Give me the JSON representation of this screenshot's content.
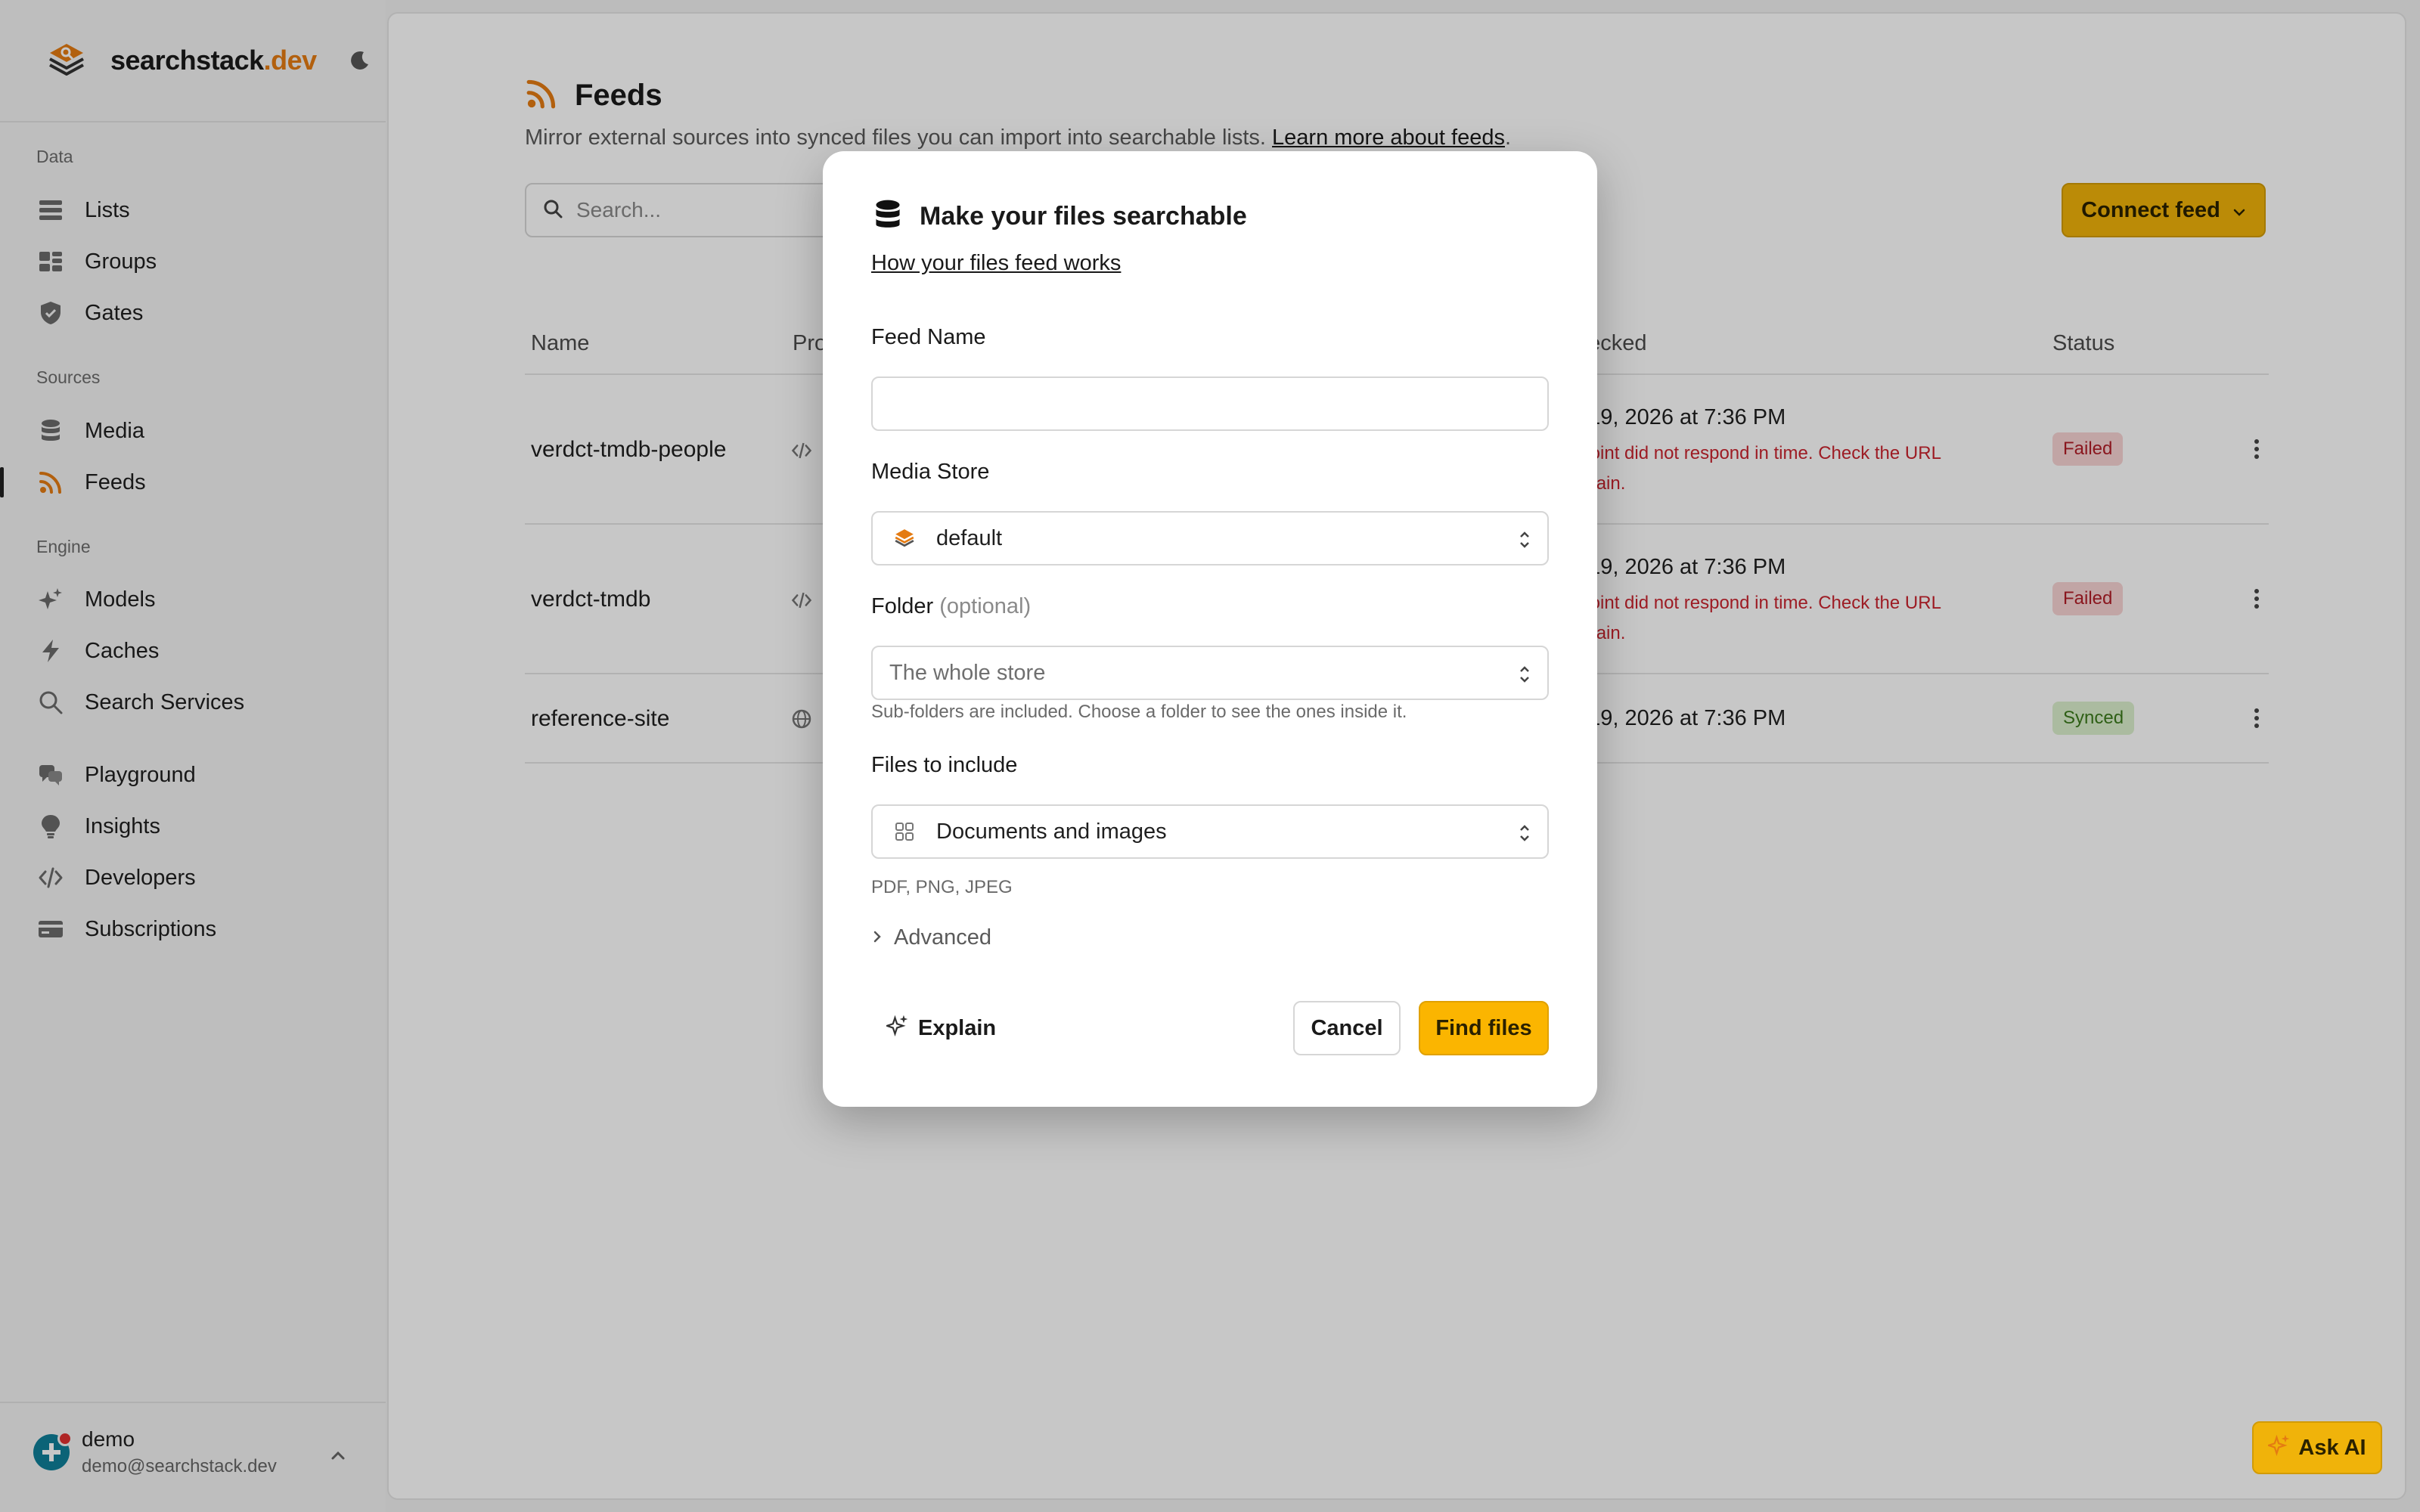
{
  "brand": {
    "name": "searchstack",
    "tld": ".dev",
    "logo_icon": "stack-search-icon",
    "theme_icon": "moon-icon"
  },
  "colors": {
    "accent": "#f0b30a",
    "brand_orange": "#e47b12",
    "error": "#c9242f",
    "failed_bg": "#f8d4d4",
    "synced_bg": "#dcf0cd"
  },
  "sidebar": {
    "sections": {
      "data": "Data",
      "sources": "Sources",
      "engine": "Engine"
    },
    "items": {
      "lists": {
        "label": "Lists",
        "icon": "list-icon"
      },
      "groups": {
        "label": "Groups",
        "icon": "groups-icon"
      },
      "gates": {
        "label": "Gates",
        "icon": "shield-icon"
      },
      "media": {
        "label": "Media",
        "icon": "database-icon"
      },
      "feeds": {
        "label": "Feeds",
        "icon": "rss-icon",
        "active": true
      },
      "models": {
        "label": "Models",
        "icon": "sparkles-icon"
      },
      "caches": {
        "label": "Caches",
        "icon": "bolt-icon"
      },
      "search_services": {
        "label": "Search Services",
        "icon": "search-icon"
      },
      "playground": {
        "label": "Playground",
        "icon": "chat-icon"
      },
      "insights": {
        "label": "Insights",
        "icon": "lightbulb-icon"
      },
      "developers": {
        "label": "Developers",
        "icon": "code-icon"
      },
      "subscriptions": {
        "label": "Subscriptions",
        "icon": "credit-card-icon"
      }
    },
    "user": {
      "name": "demo",
      "email": "demo@searchstack.dev"
    }
  },
  "page": {
    "title": "Feeds",
    "subtitle": "Mirror external sources into synced files you can import into searchable lists.",
    "learn_more": "Learn more about feeds",
    "period": ".",
    "search_placeholder": "Search...",
    "connect_label": "Connect feed"
  },
  "table": {
    "columns": {
      "name": "Name",
      "provider": "Pro",
      "checked": "hecked",
      "status": "Status"
    },
    "rows": [
      {
        "name": "verdct-tmdb-people",
        "provider_icon": "code-icon",
        "checked": ": 19, 2026 at 7:36 PM",
        "error_line1": "lpoint did not respond in time. Check the URL",
        "error_line2": "again.",
        "status": "Failed"
      },
      {
        "name": "verdct-tmdb",
        "provider_icon": "code-icon",
        "checked": ": 19, 2026 at 7:36 PM",
        "error_line1": "lpoint did not respond in time. Check the URL",
        "error_line2": "again.",
        "status": "Failed"
      },
      {
        "name": "reference-site",
        "provider_icon": "globe-icon",
        "checked": ": 19, 2026 at 7:36 PM",
        "status": "Synced"
      }
    ]
  },
  "ask_ai": {
    "label": "Ask AI"
  },
  "modal": {
    "title": "Make your files searchable",
    "how_link": "How your files feed works",
    "feed_name": {
      "label": "Feed Name",
      "value": "",
      "placeholder": ""
    },
    "media_store": {
      "label": "Media Store",
      "value": "default"
    },
    "folder": {
      "label": "Folder",
      "optional": "(optional)",
      "value": "The whole store",
      "help": "Sub-folders are included. Choose a folder to see the ones inside it."
    },
    "files": {
      "label": "Files to include",
      "value": "Documents and images",
      "help": "PDF, PNG, JPEG"
    },
    "advanced": "Advanced",
    "explain": "Explain",
    "cancel": "Cancel",
    "submit": "Find files"
  }
}
